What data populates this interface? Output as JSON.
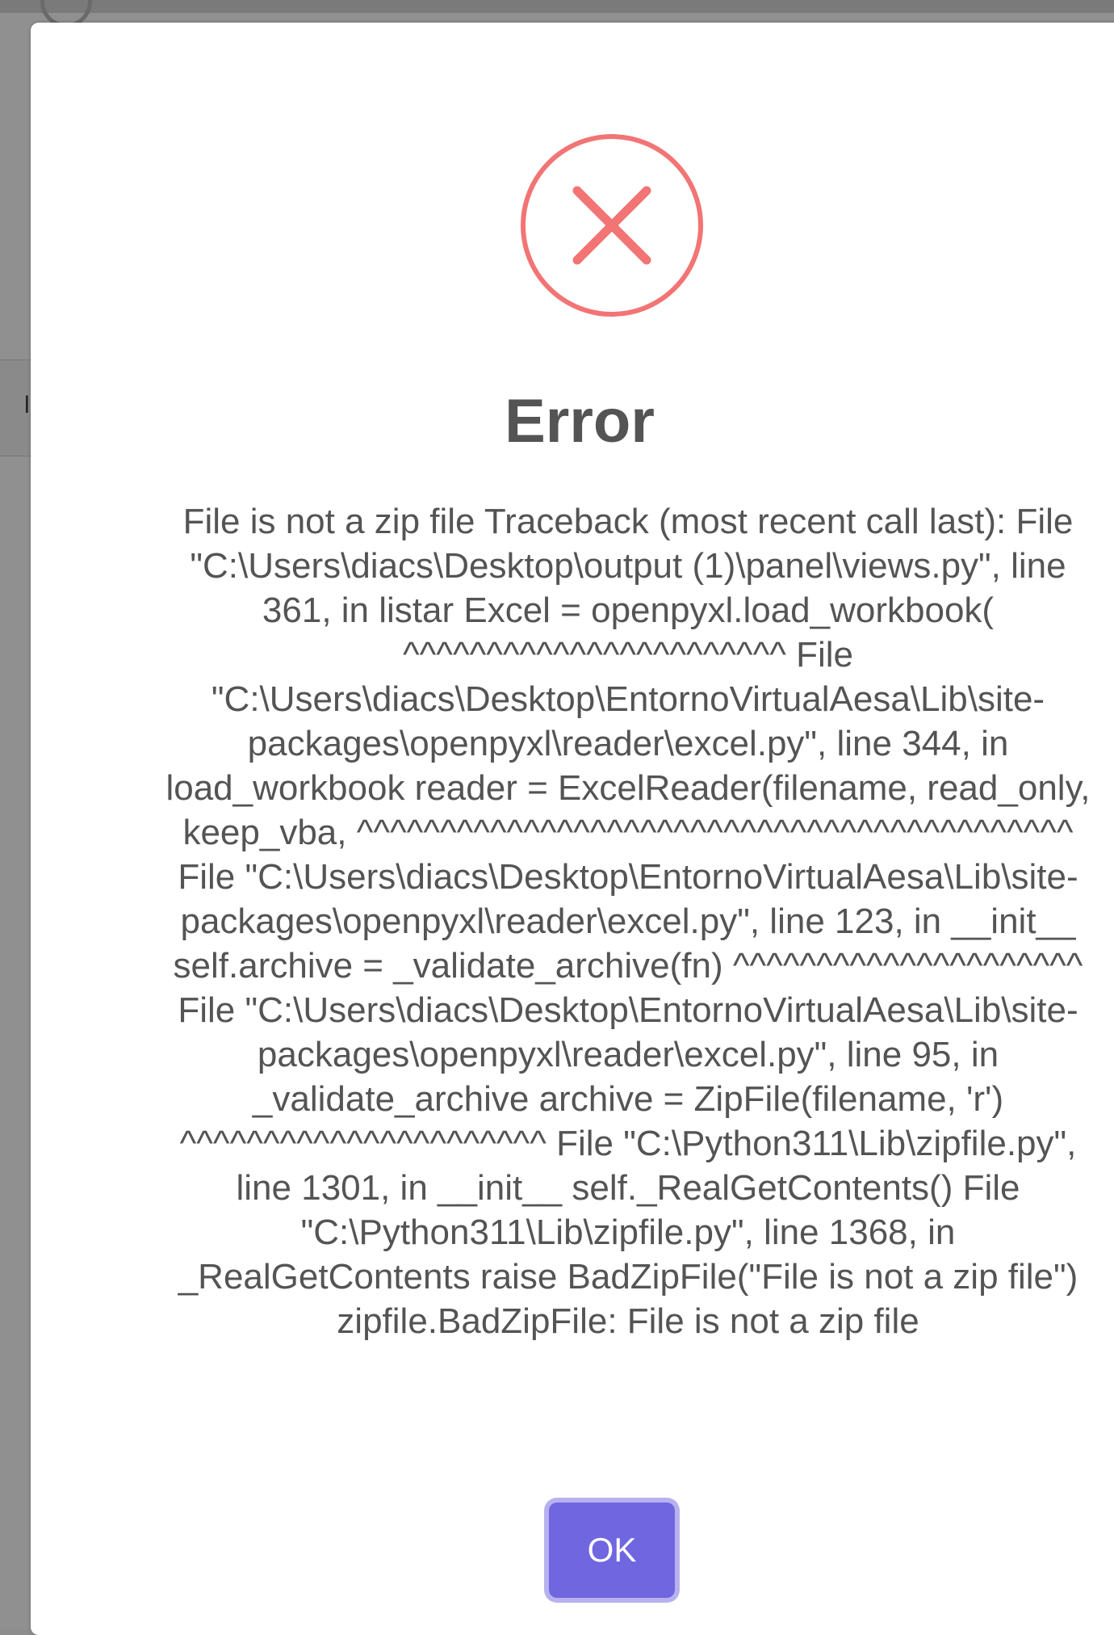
{
  "dialog": {
    "title": "Error",
    "message": "File is not a zip file Traceback (most recent call last): File \"C:\\Users\\diacs\\Desktop\\output (1)\\panel\\views.py\", line 361, in listar Excel = openpyxl.load_workbook( ^^^^^^^^^^^^^^^^^^^^^^^ File \"C:\\Users\\diacs\\Desktop\\EntornoVirtualAesa\\Lib\\site-packages\\openpyxl\\reader\\excel.py\", line 344, in load_workbook reader = ExcelReader(filename, read_only, keep_vba, ^^^^^^^^^^^^^^^^^^^^^^^^^^^^^^^^^^^^^^^^^^^ File \"C:\\Users\\diacs\\Desktop\\EntornoVirtualAesa\\Lib\\site-packages\\openpyxl\\reader\\excel.py\", line 123, in __init__ self.archive = _validate_archive(fn) ^^^^^^^^^^^^^^^^^^^^^ File \"C:\\Users\\diacs\\Desktop\\EntornoVirtualAesa\\Lib\\site-packages\\openpyxl\\reader\\excel.py\", line 95, in _validate_archive archive = ZipFile(filename, 'r') ^^^^^^^^^^^^^^^^^^^^^^ File \"C:\\Python311\\Lib\\zipfile.py\", line 1301, in __init__ self._RealGetContents() File \"C:\\Python311\\Lib\\zipfile.py\", line 1368, in _RealGetContents raise BadZipFile(\"File is not a zip file\") zipfile.BadZipFile: File is not a zip file",
    "ok_label": "OK",
    "icon": "error-x-circle-icon"
  },
  "colors": {
    "icon_red": "#f27474",
    "title_text": "#545454",
    "message_text": "#545454",
    "confirm_button": "#7066e0",
    "overlay": "#909090"
  }
}
